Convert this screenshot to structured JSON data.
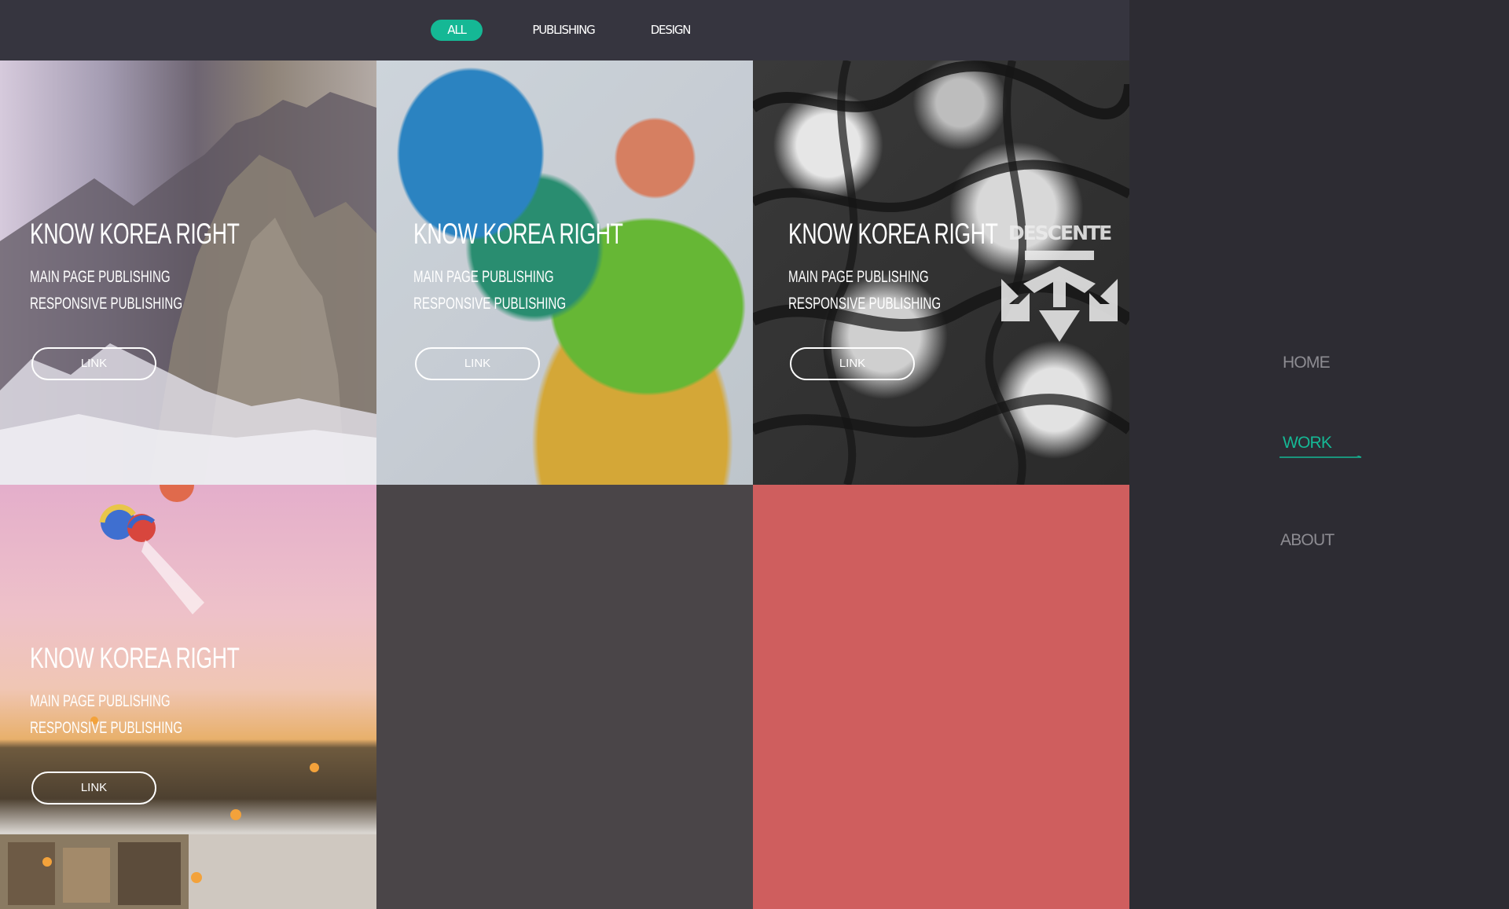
{
  "filters": {
    "all": "ALL",
    "publishing": "PUBLISHING",
    "design": "DESIGN",
    "active_color": "#15b895"
  },
  "tiles": [
    {
      "title": "KNOW KOREA RIGHT",
      "line1": "MAIN PAGE PUBLISHING",
      "line2": "RESPONSIVE PUBLISHING",
      "link": "LINK",
      "image": "mountain-photo"
    },
    {
      "title": "KNOW KOREA RIGHT",
      "line1": "MAIN PAGE PUBLISHING",
      "line2": "RESPONSIVE PUBLISHING",
      "link": "LINK",
      "image": "watercolor-paint-photo"
    },
    {
      "title": "KNOW KOREA RIGHT",
      "line1": "MAIN PAGE PUBLISHING",
      "line2": "RESPONSIVE PUBLISHING",
      "link": "LINK",
      "image": "monochrome-water-photo",
      "logo": "DESCENTE"
    },
    {
      "title": "KNOW KOREA RIGHT",
      "line1": "MAIN PAGE PUBLISHING",
      "line2": "RESPONSIVE PUBLISHING",
      "link": "LINK",
      "image": "balloon-village-photo"
    },
    {
      "color": "#4a4548"
    },
    {
      "color": "#cf5e5e"
    }
  ],
  "nav": {
    "home": "HOME",
    "work": "WORK",
    "about": "ABOUT",
    "active": "WORK",
    "accent": "#15b895"
  }
}
